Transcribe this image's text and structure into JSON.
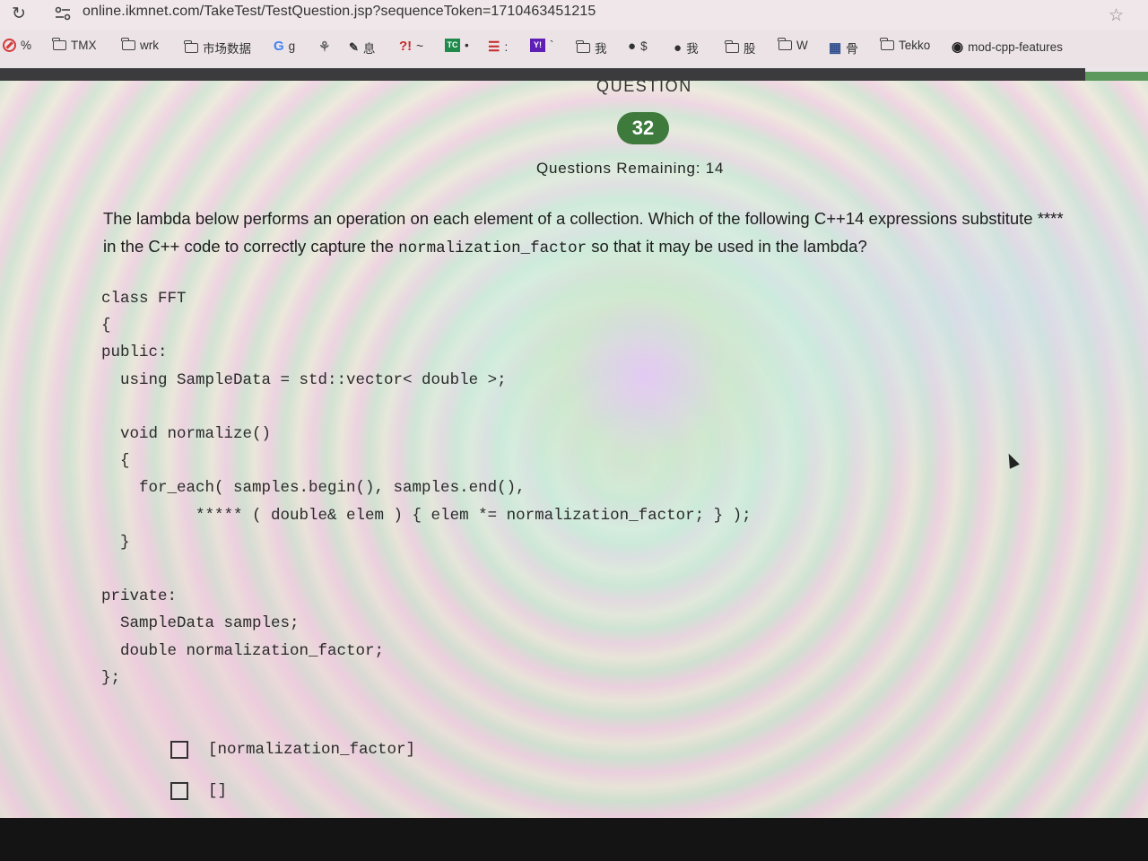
{
  "browser": {
    "url": "online.ikmnet.com/TakeTest/TestQuestion.jsp?sequenceToken=1710463451215",
    "icons": [
      "reload-icon",
      "site-info-icon",
      "bookmark-star-icon"
    ]
  },
  "bookmarks": [
    {
      "label": "%",
      "icon": "no-entry-icon"
    },
    {
      "label": "TMX",
      "icon": "folder-icon"
    },
    {
      "label": "wrk",
      "icon": "folder-icon"
    },
    {
      "label": "市场数据",
      "icon": "folder-icon"
    },
    {
      "label": "g",
      "icon": "google-icon",
      "glyph": "G"
    },
    {
      "label": "",
      "icon": "plant-icon",
      "glyph": "⚘"
    },
    {
      "label": "息",
      "icon": "brush-icon",
      "glyph": "🖌"
    },
    {
      "label": "~",
      "icon": "exclaim-icon",
      "glyph": "?!"
    },
    {
      "label": "•",
      "icon": "tc-icon",
      "glyph": "TC"
    },
    {
      "label": ":",
      "icon": "stack-icon",
      "glyph": "☰"
    },
    {
      "label": "`",
      "icon": "yahoo-icon",
      "glyph": "Y!"
    },
    {
      "label": "我",
      "icon": "folder-icon"
    },
    {
      "label": "$",
      "icon": "globe-icon",
      "glyph": "●"
    },
    {
      "label": "我",
      "icon": "globe-icon",
      "glyph": "●"
    },
    {
      "label": "股",
      "icon": "folder-icon"
    },
    {
      "label": "W",
      "icon": "folder-icon"
    },
    {
      "label": "骨",
      "icon": "grid-icon",
      "glyph": "▦"
    },
    {
      "label": "Tekko",
      "icon": "folder-icon"
    },
    {
      "label": "mod-cpp-features",
      "icon": "github-icon",
      "glyph": "◉"
    }
  ],
  "question": {
    "label": "QUESTION",
    "number": "32",
    "remaining": "Questions Remaining: 14",
    "text_part1": "The lambda below performs an operation on each element of a collection. Which of the following C++14 expressions substitute ****",
    "text_part2": "in the C++ code to correctly capture the",
    "text_code": "normalization_factor",
    "text_part3": " so that it may be used in the lambda?"
  },
  "code": {
    "lines": [
      "class FFT",
      "{",
      "public:",
      "  using SampleData = std::vector< double >;",
      "",
      "  void normalize()",
      "  {",
      "    for_each( samples.begin(), samples.end(),",
      "          ***** ( double& elem ) { elem *= normalization_factor; } );",
      "  }",
      "",
      "private:",
      "  SampleData samples;",
      "  double normalization_factor;",
      "};"
    ]
  },
  "options": [
    {
      "label": "[normalization_factor]",
      "checked": false
    },
    {
      "label": "[]",
      "checked": false
    }
  ],
  "colors": {
    "badge": "#3d7a3c",
    "accent_box": "#5b9a5c"
  }
}
